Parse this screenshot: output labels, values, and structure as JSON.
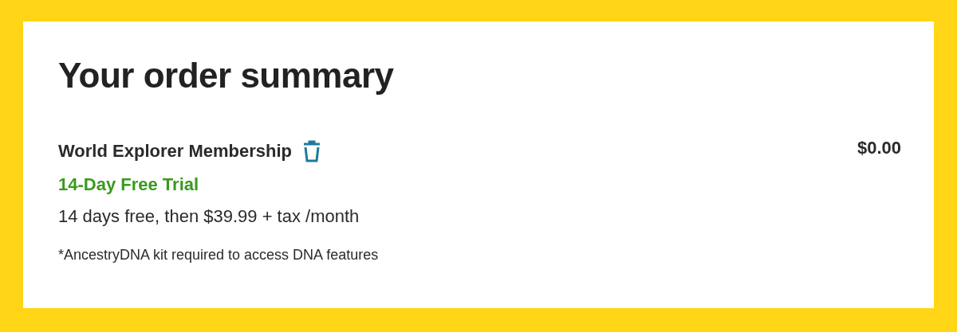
{
  "title": "Your order summary",
  "item": {
    "name": "World Explorer Membership",
    "trial": "14-Day Free Trial",
    "terms": "14 days free, then $39.99 + tax /month",
    "note": "*AncestryDNA kit required to access DNA features",
    "price": "$0.00"
  }
}
